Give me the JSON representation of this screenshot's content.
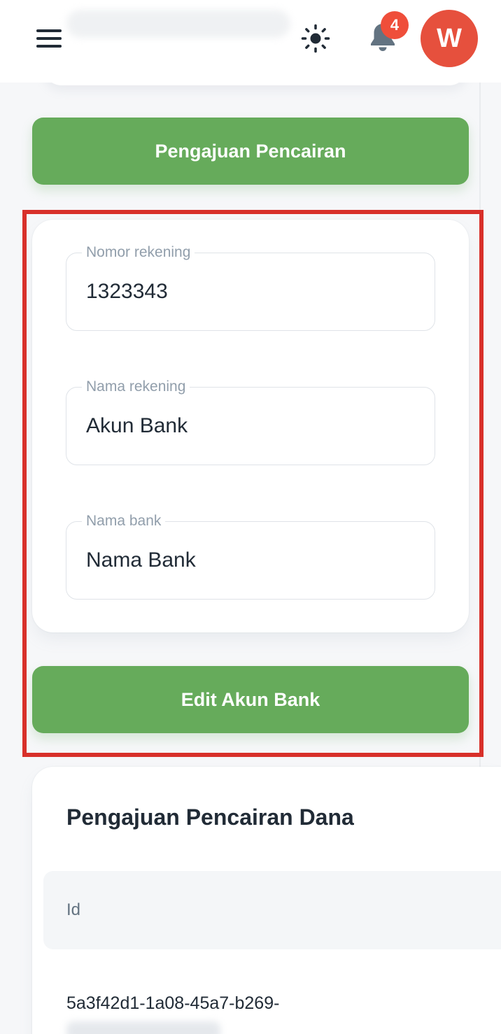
{
  "header": {
    "menu_icon": "menu-icon",
    "theme_icon": "sun-icon",
    "notifications": {
      "icon": "bell-icon",
      "count": "4"
    },
    "avatar_initial": "W"
  },
  "actions": {
    "withdraw_request_label": "Pengajuan Pencairan",
    "edit_bank_label": "Edit Akun Bank"
  },
  "bank_form": {
    "account_number": {
      "label": "Nomor rekening",
      "value": "1323343"
    },
    "account_name": {
      "label": "Nama rekening",
      "value": "Akun Bank"
    },
    "bank_name": {
      "label": "Nama bank",
      "value": "Nama Bank"
    }
  },
  "withdrawals": {
    "title": "Pengajuan Pencairan Dana",
    "columns": [
      "Id"
    ],
    "rows": [
      {
        "id": "5a3f42d1-1a08-45a7-b269-"
      }
    ]
  },
  "colors": {
    "primary_green": "#66ab5b",
    "badge_red": "#ef4e3a",
    "avatar_red": "#e6503d",
    "highlight_red": "#d8302a"
  }
}
